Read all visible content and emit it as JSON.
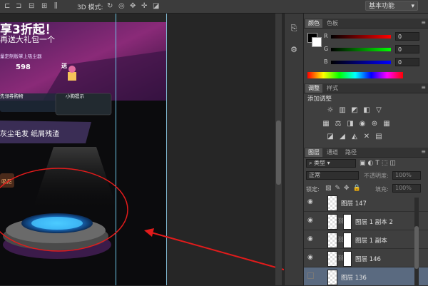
{
  "options_bar": {
    "mode_3d_label": "3D 模式:",
    "workspace": "基本功能",
    "icons": [
      "rotate-3d-icon",
      "roll-3d-icon",
      "pan-3d-icon",
      "slide-3d-icon",
      "scale-3d-icon"
    ]
  },
  "canvas": {
    "banner_title": "享3折起！",
    "banner_sub": "再送大礼包一个",
    "promo_small": "量定制版掌上吸尘器",
    "price": "598",
    "gift_tag": "送",
    "coupon_left": "先领券购物",
    "coupon_right": "小狗提示",
    "ribbon_text": "灰尘毛发  纸屑残渣",
    "pill_text": "吸尼",
    "annotation_colors": {
      "circle": "#e21b1b",
      "arrow": "#e21b1b"
    }
  },
  "color_panel": {
    "tabs": [
      "颜色",
      "色板"
    ],
    "channels": [
      {
        "label": "R",
        "value": "0"
      },
      {
        "label": "G",
        "value": "0"
      },
      {
        "label": "B",
        "value": "0"
      }
    ]
  },
  "adjust_panel": {
    "tabs": [
      "调整",
      "样式"
    ],
    "title": "添加调整",
    "row1": [
      "brightness-icon",
      "levels-icon",
      "curves-icon",
      "exposure-icon",
      "vibrance-icon"
    ],
    "row2": [
      "hue-icon",
      "color-balance-icon",
      "bw-icon",
      "photo-filter-icon",
      "channel-mixer-icon",
      "color-lookup-icon"
    ],
    "row3": [
      "invert-icon",
      "posterize-icon",
      "threshold-icon",
      "selective-color-icon",
      "gradient-map-icon"
    ]
  },
  "layers_panel": {
    "tabs": [
      "图层",
      "通道",
      "路径"
    ],
    "filter_label": "类型",
    "blend_mode": "正常",
    "opacity_label": "不透明度:",
    "opacity_value": "100%",
    "lock_label": "锁定:",
    "fill_label": "填充:",
    "fill_value": "100%",
    "layers": [
      {
        "name": "图层 147",
        "visible": true,
        "mask": false,
        "selected": false
      },
      {
        "name": "图层 1 副本 2",
        "visible": true,
        "mask": true,
        "selected": false
      },
      {
        "name": "图层 1 副本",
        "visible": true,
        "mask": true,
        "selected": false
      },
      {
        "name": "图层 146",
        "visible": true,
        "mask": true,
        "selected": false
      },
      {
        "name": "图层 136",
        "visible": false,
        "mask": false,
        "selected": true
      }
    ]
  }
}
